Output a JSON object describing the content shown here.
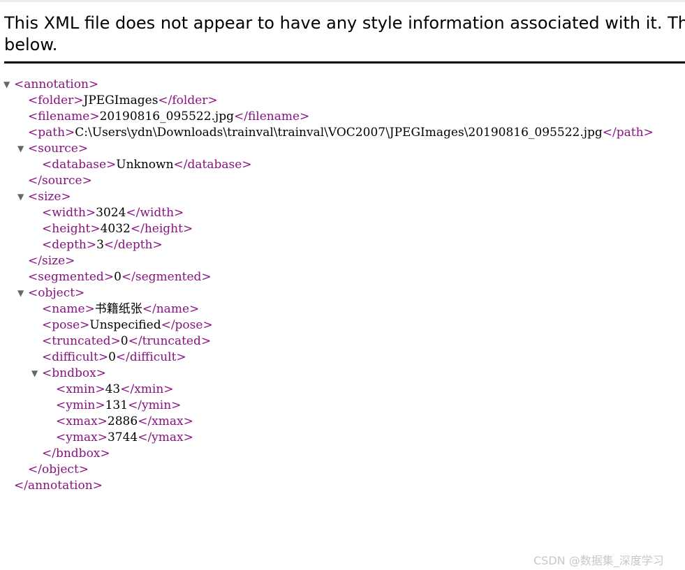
{
  "header": {
    "line1": "This XML file does not appear to have any style information associated with it. The do",
    "line2": "below."
  },
  "tree": {
    "annotation_open": "<annotation>",
    "annotation_close": "</annotation>",
    "toggle_glyph": "▼",
    "folder": {
      "open": "<folder>",
      "value": "JPEGImages",
      "close": "</folder>"
    },
    "filename": {
      "open": "<filename>",
      "value": "20190816_095522.jpg",
      "close": "</filename>"
    },
    "path": {
      "open": "<path>",
      "value": "C:\\Users\\ydn\\Downloads\\trainval\\trainval\\VOC2007\\JPEGImages\\20190816_095522.jpg",
      "close": "</path>"
    },
    "source": {
      "open": "<source>",
      "close": "</source>",
      "database": {
        "open": "<database>",
        "value": "Unknown",
        "close": "</database>"
      }
    },
    "size": {
      "open": "<size>",
      "close": "</size>",
      "width": {
        "open": "<width>",
        "value": "3024",
        "close": "</width>"
      },
      "height": {
        "open": "<height>",
        "value": "4032",
        "close": "</height>"
      },
      "depth": {
        "open": "<depth>",
        "value": "3",
        "close": "</depth>"
      }
    },
    "segmented": {
      "open": "<segmented>",
      "value": "0",
      "close": "</segmented>"
    },
    "object": {
      "open": "<object>",
      "close": "</object>",
      "name": {
        "open": "<name>",
        "value": "书籍纸张",
        "close": "</name>"
      },
      "pose": {
        "open": "<pose>",
        "value": "Unspecified",
        "close": "</pose>"
      },
      "truncated": {
        "open": "<truncated>",
        "value": "0",
        "close": "</truncated>"
      },
      "difficult": {
        "open": "<difficult>",
        "value": "0",
        "close": "</difficult>"
      },
      "bndbox": {
        "open": "<bndbox>",
        "close": "</bndbox>",
        "xmin": {
          "open": "<xmin>",
          "value": "43",
          "close": "</xmin>"
        },
        "ymin": {
          "open": "<ymin>",
          "value": "131",
          "close": "</ymin>"
        },
        "xmax": {
          "open": "<xmax>",
          "value": "2886",
          "close": "</xmax>"
        },
        "ymax": {
          "open": "<ymax>",
          "value": "3744",
          "close": "</ymax>"
        }
      }
    }
  },
  "watermark": "CSDN @数据集_深度学习"
}
